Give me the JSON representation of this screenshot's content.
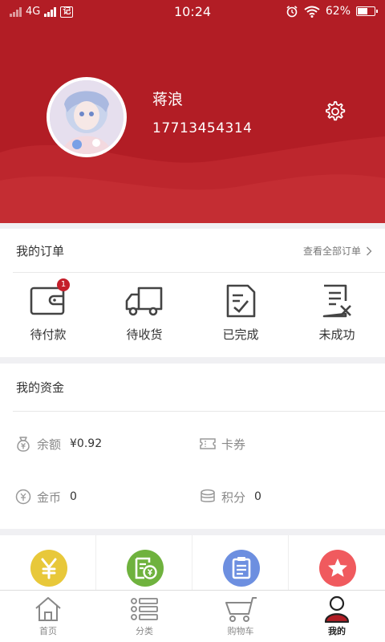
{
  "status_bar": {
    "network": "4G",
    "carrier_badge": "记",
    "time": "10:24",
    "battery": "62%",
    "battery_level": 0.62
  },
  "profile": {
    "name": "蒋浪",
    "phone": "17713454314"
  },
  "orders": {
    "title": "我的订单",
    "view_all": "查看全部订单",
    "items": [
      {
        "label": "待付款",
        "icon": "wallet-icon",
        "badge": "1"
      },
      {
        "label": "待收货",
        "icon": "truck-icon"
      },
      {
        "label": "已完成",
        "icon": "completed-doc-icon"
      },
      {
        "label": "未成功",
        "icon": "failed-doc-icon"
      }
    ]
  },
  "funds": {
    "title": "我的资金",
    "balance_label": "余额",
    "balance_value": "¥0.92",
    "coupons_label": "卡券",
    "coins_label": "金币",
    "coins_value": "0",
    "points_label": "积分",
    "points_value": "0"
  },
  "shortcuts": [
    {
      "icon": "yuan-icon",
      "color": "#e8c83a"
    },
    {
      "icon": "voucher-icon",
      "color": "#6fb23e"
    },
    {
      "icon": "clipboard-icon",
      "color": "#6d8fe0"
    },
    {
      "icon": "star-icon",
      "color": "#f05a5e"
    }
  ],
  "tabs": [
    {
      "label": "首页",
      "icon": "home-icon"
    },
    {
      "label": "分类",
      "icon": "list-icon"
    },
    {
      "label": "购物车",
      "icon": "cart-icon"
    },
    {
      "label": "我的",
      "icon": "user-icon",
      "active": true
    }
  ],
  "colors": {
    "brand": "#b21d25",
    "badge": "#c41e2a"
  }
}
